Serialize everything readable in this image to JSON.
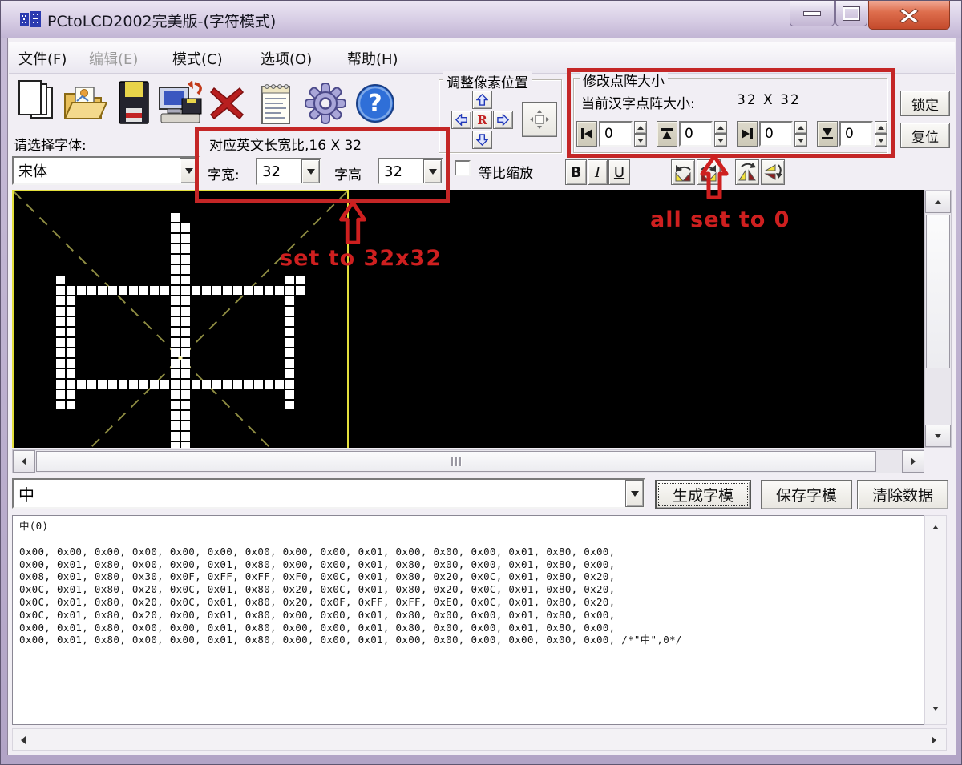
{
  "window": {
    "title": "PCtoLCD2002完美版-(字符模式)"
  },
  "menu": {
    "file": "文件(F)",
    "edit": "编辑(E)",
    "mode": "模式(C)",
    "options": "选项(O)",
    "help": "帮助(H)"
  },
  "toolbar": {
    "icons": [
      "new-file",
      "open-file",
      "save",
      "save-to-pc",
      "delete",
      "view-code",
      "settings",
      "help"
    ]
  },
  "font_panel": {
    "label": "请选择字体:",
    "value": "宋体"
  },
  "size_panel": {
    "ratio_label": "对应英文长宽比,16 X 32",
    "width_label": "字宽:",
    "width_value": "32",
    "height_label": "字高",
    "height_value": "32",
    "annotation": "set to 32x32"
  },
  "scale_lock": {
    "label": "等比缩放",
    "checked": false
  },
  "pixel_pos": {
    "title": "调整像素位置",
    "r_label": "R"
  },
  "matrix_panel": {
    "title": "修改点阵大小",
    "current_label": "当前汉字点阵大小:",
    "current_value": "32 X 32",
    "left": "0",
    "top": "0",
    "right": "0",
    "bottom": "0",
    "annotation": "all set to 0"
  },
  "side_buttons": {
    "lock": "锁定",
    "reset": "复位"
  },
  "format": {
    "bold": "B",
    "italic": "I",
    "underline": "U"
  },
  "preview_input": {
    "value": "中"
  },
  "actions": {
    "generate": "生成字模",
    "save": "保存字模",
    "clear": "清除数据"
  },
  "output": {
    "header": "中(0)",
    "lines": [
      "0x00, 0x00, 0x00, 0x00, 0x00, 0x00, 0x00, 0x00, 0x00, 0x01, 0x00, 0x00, 0x00, 0x01, 0x80, 0x00,",
      "0x00, 0x01, 0x80, 0x00, 0x00, 0x01, 0x80, 0x00, 0x00, 0x01, 0x80, 0x00, 0x00, 0x01, 0x80, 0x00,",
      "0x08, 0x01, 0x80, 0x30, 0x0F, 0xFF, 0xFF, 0xF0, 0x0C, 0x01, 0x80, 0x20, 0x0C, 0x01, 0x80, 0x20,",
      "0x0C, 0x01, 0x80, 0x20, 0x0C, 0x01, 0x80, 0x20, 0x0C, 0x01, 0x80, 0x20, 0x0C, 0x01, 0x80, 0x20,",
      "0x0C, 0x01, 0x80, 0x20, 0x0C, 0x01, 0x80, 0x20, 0x0F, 0xFF, 0xFF, 0xE0, 0x0C, 0x01, 0x80, 0x20,",
      "0x0C, 0x01, 0x80, 0x20, 0x00, 0x01, 0x80, 0x00, 0x00, 0x01, 0x80, 0x00, 0x00, 0x01, 0x80, 0x00,",
      "0x00, 0x01, 0x80, 0x00, 0x00, 0x01, 0x80, 0x00, 0x00, 0x01, 0x80, 0x00, 0x00, 0x01, 0x80, 0x00,",
      "0x00, 0x01, 0x80, 0x00, 0x00, 0x01, 0x80, 0x00, 0x00, 0x01, 0x00, 0x00, 0x00, 0x00, 0x00, 0x00, /*\"中\",0*/"
    ]
  },
  "colors": {
    "annotation_red": "#ce1f1f",
    "pixel": "#ffffff",
    "guide": "#8e8c42",
    "canvas": "#000000"
  }
}
